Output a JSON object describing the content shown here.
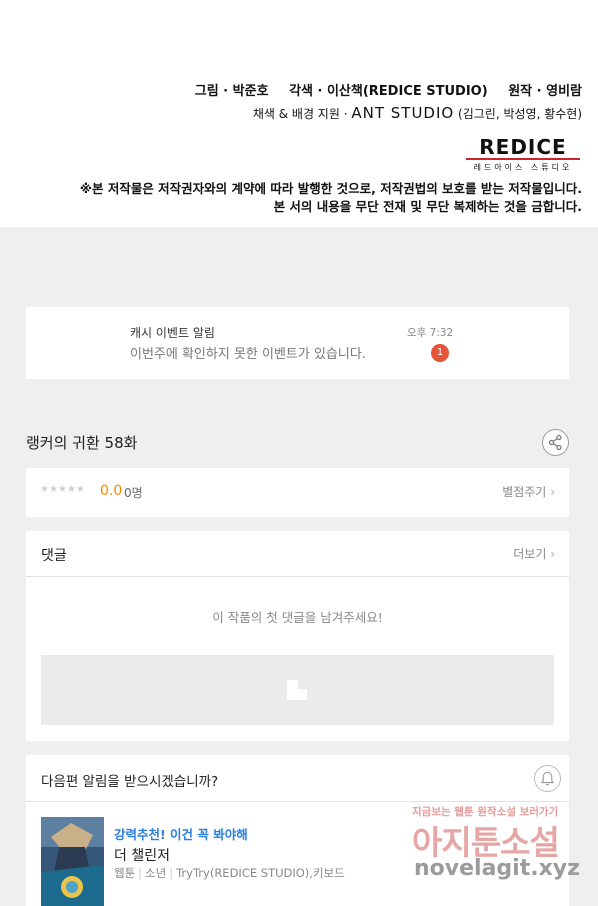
{
  "credits": {
    "art": "그림 · 박준호",
    "script": "각색 · 이산책(REDICE STUDIO)",
    "original": "원작 · 영비람",
    "assist_prefix": "채색 & 배경 지원 · ",
    "assist_studio": "ANT STUDIO",
    "assist_members": " (김그린, 박성영, 황수현)",
    "logo_main": "REDICE",
    "logo_sub": "레드아이스 스튜디오",
    "notice_line1": "※본 저작물은 저작권자와의 계약에 따라 발행한 것으로, 저작권법의 보호를 받는 저작물입니다.",
    "notice_line2": "본 서의 내용을 무단 전재 및 무단 복제하는 것을 금합니다."
  },
  "notification": {
    "title": "캐시 이벤트 알림",
    "message": "이번주에 확인하지 못한 이벤트가 있습니다.",
    "time": "오후 7:32",
    "badge": "1"
  },
  "episode": {
    "title": "랭커의 귀환 58화"
  },
  "rating": {
    "stars": "★★★★★",
    "score": "0.0",
    "count": "0명",
    "rate_label": "별점주기"
  },
  "comments": {
    "label": "댓글",
    "more_label": "더보기",
    "empty_text": "이 작품의 첫 댓글을 남겨주세요!"
  },
  "next_episode": {
    "question": "다음편 알림을 받으시겠습니까?",
    "recommend": "강력추천! 이건 꼭 봐야해",
    "work_title": "더 챌린저",
    "meta_type": "웹툰",
    "meta_genre": "소년",
    "meta_authors": "TryTry(REDICE STUDIO),키보드"
  },
  "watermark": {
    "top": "지금보는 웹툰 원작소설 보러가기",
    "brand": "아지툰소설",
    "url": "novelagit.xyz"
  },
  "colors": {
    "accent_orange": "#f08c00",
    "badge_red": "#e4553a",
    "recommend_blue": "#2a7de1"
  }
}
